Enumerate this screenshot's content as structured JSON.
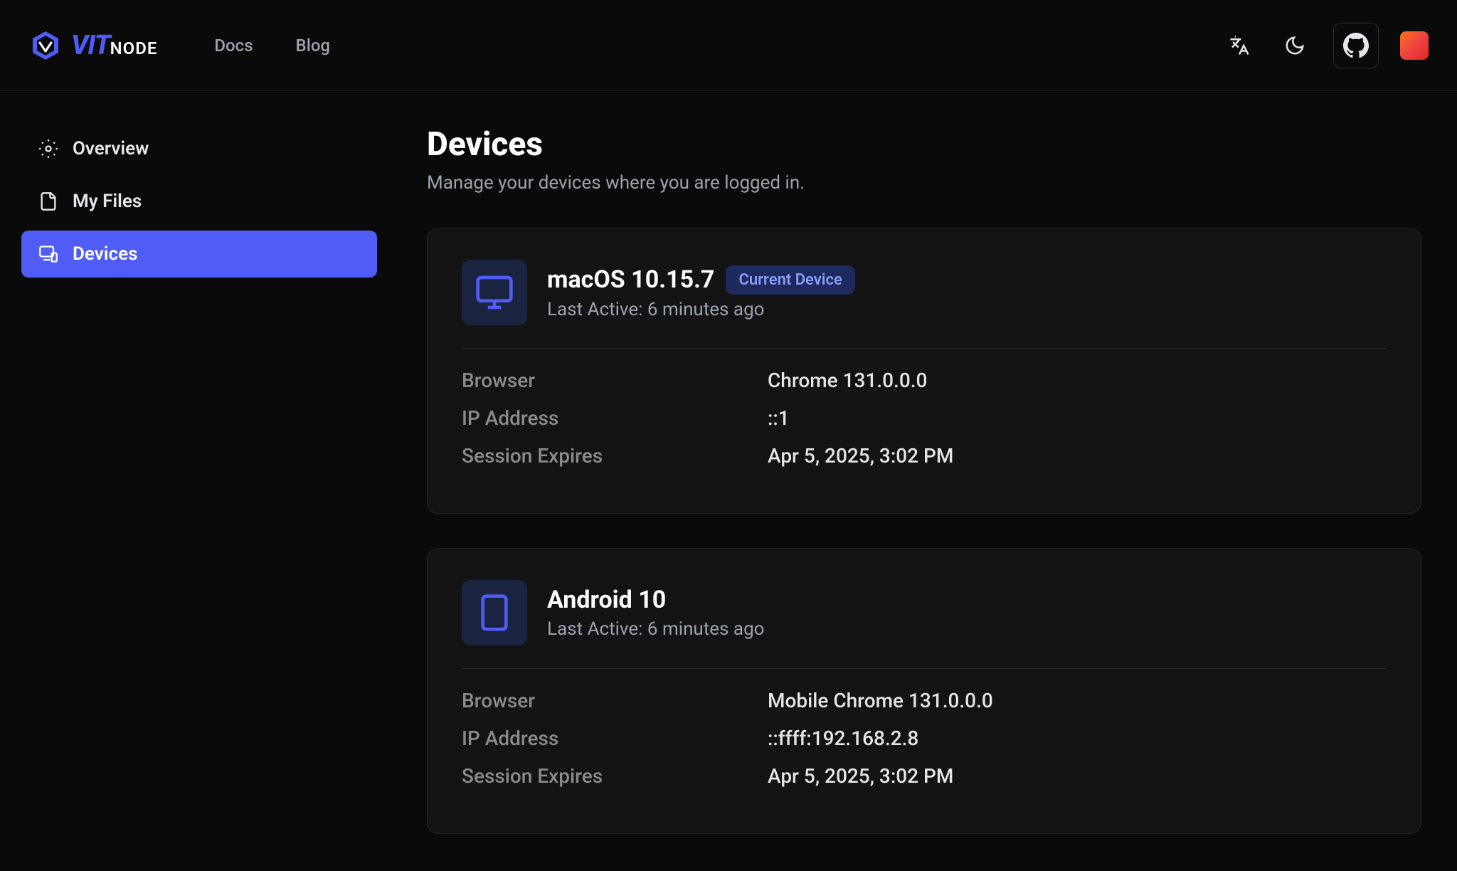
{
  "header": {
    "logo": {
      "vit": "VIT",
      "node": "NODE"
    },
    "nav": {
      "docs": "Docs",
      "blog": "Blog"
    }
  },
  "sidebar": {
    "items": [
      {
        "label": "Overview",
        "icon": "gear"
      },
      {
        "label": "My Files",
        "icon": "files"
      },
      {
        "label": "Devices",
        "icon": "device"
      }
    ]
  },
  "page": {
    "title": "Devices",
    "subtitle": "Manage your devices where you are logged in."
  },
  "labels": {
    "current_device": "Current Device",
    "last_active": "Last Active:",
    "browser": "Browser",
    "ip_address": "IP Address",
    "session_expires": "Session Expires"
  },
  "devices": [
    {
      "name": "macOS 10.15.7",
      "is_current": true,
      "last_active": "6 minutes ago",
      "browser": "Chrome 131.0.0.0",
      "ip": "::1",
      "expires": "Apr 5, 2025, 3:02 PM",
      "icon": "desktop"
    },
    {
      "name": "Android 10",
      "is_current": false,
      "last_active": "6 minutes ago",
      "browser": "Mobile Chrome 131.0.0.0",
      "ip": "::ffff:192.168.2.8",
      "expires": "Apr 5, 2025, 3:02 PM",
      "icon": "mobile"
    }
  ]
}
